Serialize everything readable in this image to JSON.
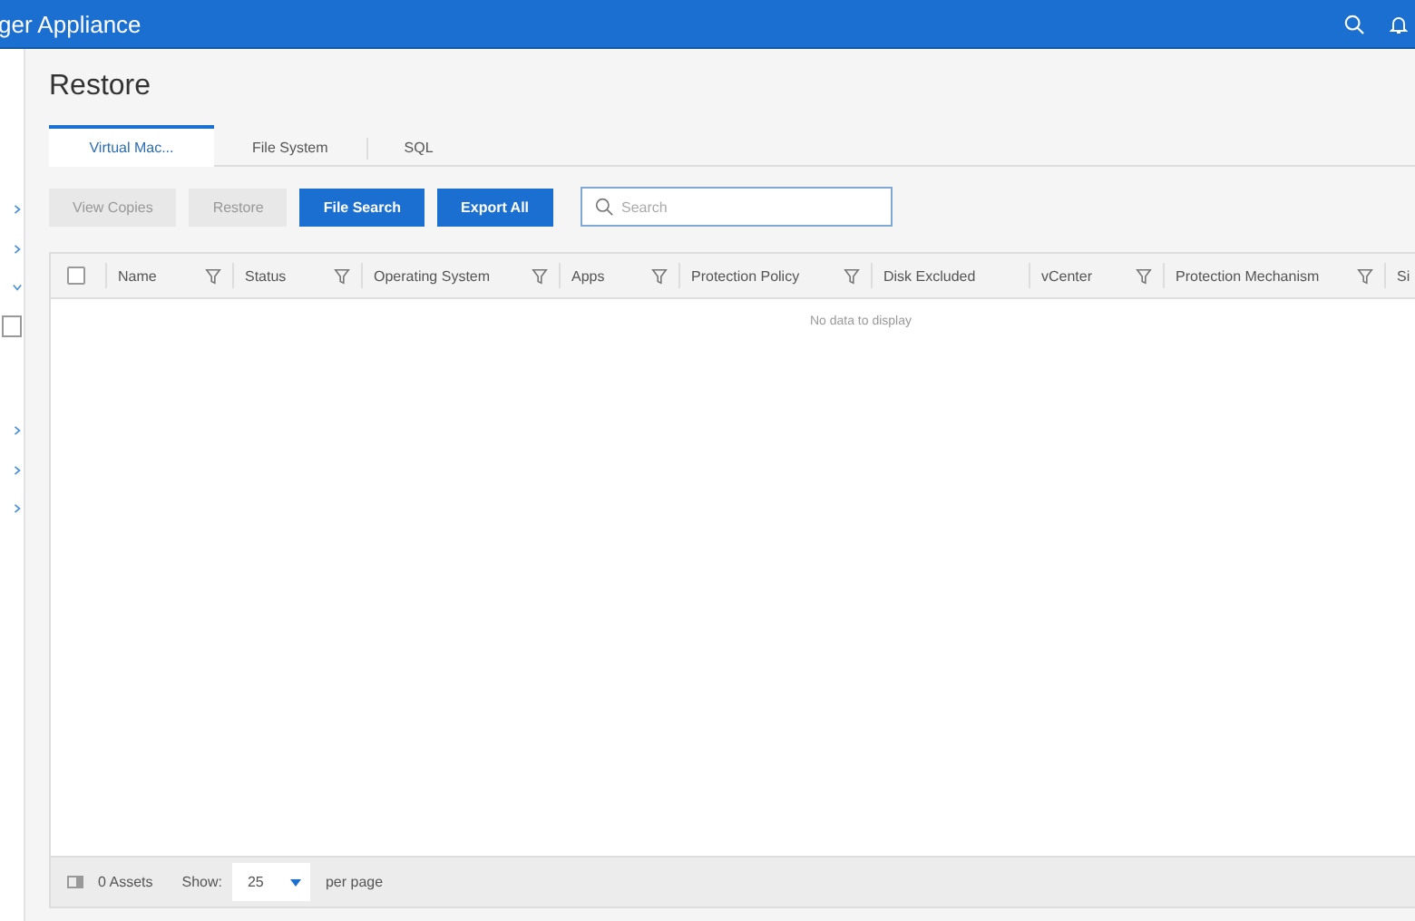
{
  "header": {
    "title": "ger Appliance"
  },
  "sidebar": {
    "items": [
      {
        "expanded": false
      },
      {
        "expanded": false
      },
      {
        "expanded": true
      },
      {
        "kind": "field"
      },
      {
        "expanded": false
      },
      {
        "expanded": false
      },
      {
        "expanded": false
      }
    ]
  },
  "page": {
    "title": "Restore"
  },
  "tabs": [
    {
      "label": "Virtual Mac...",
      "selected": true
    },
    {
      "label": "File System",
      "selected": false
    },
    {
      "label": "SQL",
      "selected": false
    }
  ],
  "toolbar": {
    "buttons": [
      {
        "label": "View Copies",
        "disabled": true
      },
      {
        "label": "Restore",
        "disabled": true
      },
      {
        "label": "File Search",
        "disabled": false
      },
      {
        "label": "Export All",
        "disabled": false
      }
    ],
    "search": {
      "placeholder": "Search"
    }
  },
  "table": {
    "select_all": {
      "checked": false
    },
    "columns": [
      {
        "label": "Name",
        "filter": true
      },
      {
        "label": "Status",
        "filter": true
      },
      {
        "label": "Operating System",
        "filter": true
      },
      {
        "label": "Apps",
        "filter": true
      },
      {
        "label": "Protection Policy",
        "filter": true
      },
      {
        "label": "Disk Excluded",
        "filter": false
      },
      {
        "label": "vCenter",
        "filter": true
      },
      {
        "label": "Protection Mechanism",
        "filter": true
      },
      {
        "label": "Si"
      }
    ],
    "empty_message": "No data to display"
  },
  "footer": {
    "count": "0 Assets",
    "show_label": "Show:",
    "page_size": "25",
    "per_page": "per page"
  }
}
